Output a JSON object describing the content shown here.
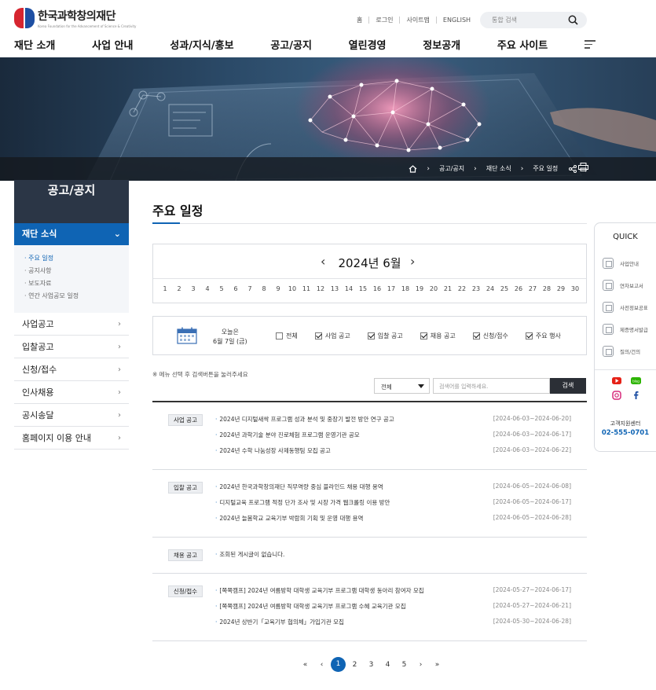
{
  "header": {
    "logo_name": "한국과학창의재단",
    "logo_en": "Korea Foundation for the Advancement of Science & Creativity",
    "util": [
      "홈",
      "로그인",
      "사이트맵",
      "ENGLISH"
    ],
    "search_placeholder": "통합 검색"
  },
  "gnb": [
    "재단 소개",
    "사업 안내",
    "성과/지식/홍보",
    "공고/공지",
    "열린경영",
    "정보공개",
    "주요 사이트"
  ],
  "breadcrumb": [
    "공고/공지",
    "재단 소식",
    "주요 일정"
  ],
  "sidebar": {
    "title": "공고/공지",
    "active": "재단 소식",
    "sub": [
      "주요 일정",
      "공지사항",
      "보도자료",
      "연간 사업공모 일정"
    ],
    "items": [
      "사업공고",
      "입찰공고",
      "신청/접수",
      "인사채용",
      "공시송달",
      "홈페이지 이용 안내"
    ]
  },
  "main": {
    "title": "주요 일정",
    "calendar": {
      "month_label": "2024년 6월",
      "days": [
        "1",
        "2",
        "3",
        "4",
        "5",
        "6",
        "7",
        "8",
        "9",
        "10",
        "11",
        "12",
        "13",
        "14",
        "15",
        "16",
        "17",
        "18",
        "19",
        "20",
        "21",
        "22",
        "23",
        "24",
        "25",
        "26",
        "27",
        "28",
        "29",
        "30"
      ]
    },
    "today_label": "오늘은",
    "today_date": "6월 7일 (금)",
    "filters": [
      {
        "label": "전체",
        "checked": false
      },
      {
        "label": "사업 공고",
        "checked": true
      },
      {
        "label": "입찰 공고",
        "checked": true
      },
      {
        "label": "채용 공고",
        "checked": true
      },
      {
        "label": "신청/접수",
        "checked": true
      },
      {
        "label": "주요 행사",
        "checked": true
      }
    ],
    "notice": "※ 메뉴 선택 후 검색버튼을 눌러주세요",
    "search_select": "전체",
    "search_placeholder": "검색어를 입력하세요.",
    "search_button": "검색",
    "groups": [
      {
        "badge": "사업 공고",
        "rows": [
          {
            "title": "2024년 디지털새싹 프로그램 성과 분석 및 중장기 발전 방안 연구 공고",
            "date": "[2024-06-03~2024-06-20]"
          },
          {
            "title": "2024년 과학기술 분야 진로체험 프로그램 운영기관 공모",
            "date": "[2024-06-03~2024-06-17]"
          },
          {
            "title": "2024년 수학 나눔성장 사제동행팀 모집 공고",
            "date": "[2024-06-03~2024-06-22]"
          }
        ]
      },
      {
        "badge": "입찰 공고",
        "rows": [
          {
            "title": "2024년 한국과학창의재단 직무역량 중심 블라인드 채용 대행 용역",
            "date": "[2024-06-05~2024-06-08]"
          },
          {
            "title": "디지털교육 프로그램 적정 단가 조사 및 시장 가격 웹크롤링 이용 방안",
            "date": "[2024-06-05~2024-06-17]"
          },
          {
            "title": "2024년 늘봄학교 교육기부 박람회 기획 및 운영 대행 용역",
            "date": "[2024-06-05~2024-06-28]"
          }
        ]
      },
      {
        "badge": "채용 공고",
        "rows": [
          {
            "title": "조회된 게시글이 없습니다.",
            "date": ""
          }
        ]
      },
      {
        "badge": "신청/접수",
        "rows": [
          {
            "title": "[쪽쪽캠프] 2024년 여름방학 대학생 교육기부 프로그램 대학생 동아리 참여자 모집",
            "date": "[2024-05-27~2024-06-17]"
          },
          {
            "title": "[쪽쪽캠프] 2024년 여름방학 대학생 교육기부 프로그램 수혜 교육기관 모집",
            "date": "[2024-05-27~2024-06-21]"
          },
          {
            "title": "2024년 상반기「교육기부 협의체」가입기관 모집",
            "date": "[2024-05-30~2024-06-28]"
          }
        ]
      }
    ],
    "pager": {
      "first": "«",
      "prev": "‹",
      "pages": [
        "1",
        "2",
        "3",
        "4",
        "5"
      ],
      "next": "›",
      "last": "»"
    }
  },
  "quick": {
    "title": "QUICK",
    "items": [
      "사업안내",
      "연차보고서",
      "사전정보공표",
      "제증명서발급",
      "질의/건의"
    ],
    "center_label": "고객지원센터",
    "center_tel": "02-555-0701"
  }
}
